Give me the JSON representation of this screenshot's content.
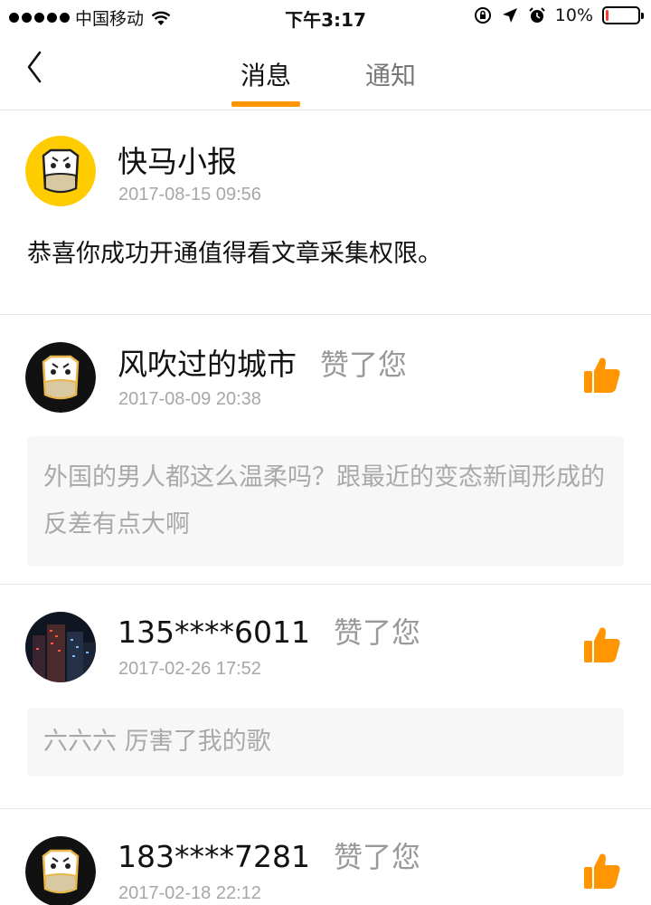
{
  "status_bar": {
    "carrier": "中国移动",
    "time": "下午3:17",
    "battery_percent": "10%",
    "battery_level": 0.1,
    "icons": [
      "signal-dots-icon",
      "wifi-icon",
      "lock-rotation-icon",
      "location-arrow-icon",
      "alarm-icon",
      "battery-icon"
    ]
  },
  "nav": {
    "back_icon": "chevron-left-icon",
    "tabs": [
      {
        "label": "消息",
        "active": true
      },
      {
        "label": "通知",
        "active": false
      }
    ],
    "accent_color": "#ff9500"
  },
  "items": [
    {
      "name": "快马小报",
      "time": "2017-08-15 09:56",
      "message": "恭喜你成功开通值得看文章采集权限。",
      "avatar": "horse-logo-yellow"
    },
    {
      "name": "风吹过的城市",
      "action": "赞了您",
      "time": "2017-08-09 20:38",
      "quote": "外国的男人都这么温柔吗？跟最近的变态新闻形成的反差有点大啊",
      "avatar": "horse-logo-dark",
      "icon": "thumbs-up-icon"
    },
    {
      "name": "135****6011",
      "action": "赞了您",
      "time": "2017-02-26 17:52",
      "quote": "六六六 厉害了我的歌",
      "avatar": "city-night-photo",
      "icon": "thumbs-up-icon"
    },
    {
      "name": "183****7281",
      "action": "赞了您",
      "time": "2017-02-18 22:12",
      "avatar": "horse-logo-dark",
      "icon": "thumbs-up-icon"
    }
  ]
}
